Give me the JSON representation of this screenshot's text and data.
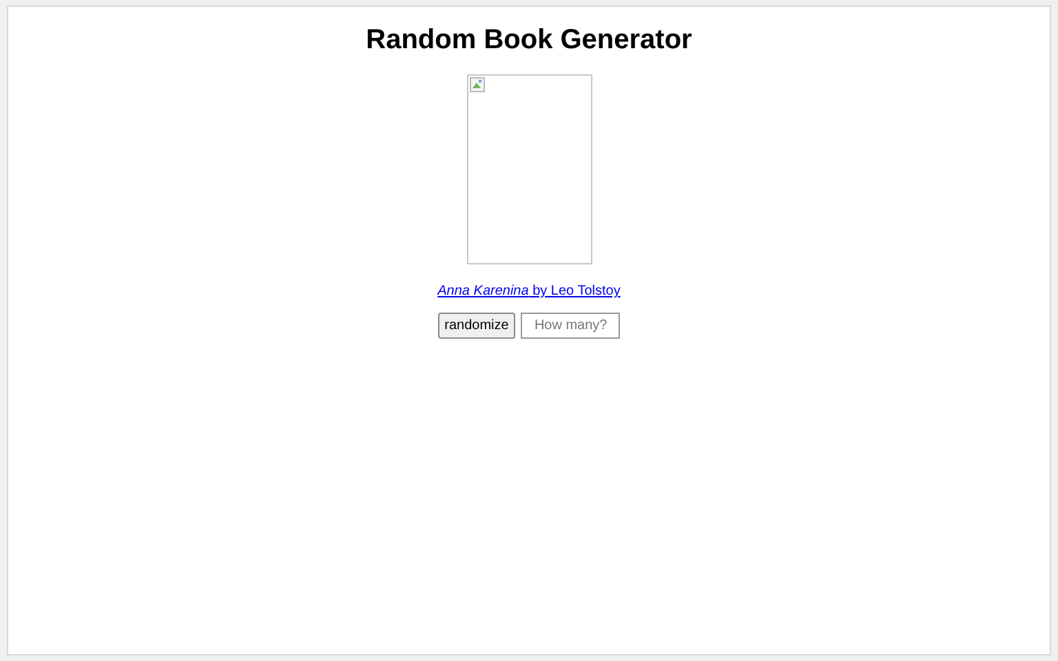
{
  "title": "Random Book Generator",
  "book": {
    "link": "*Anna Karenina* by Leo Tolstoy"
  },
  "randomize_button": "randomize",
  "count_field": {
    "placeholder": "How many?"
  }
}
